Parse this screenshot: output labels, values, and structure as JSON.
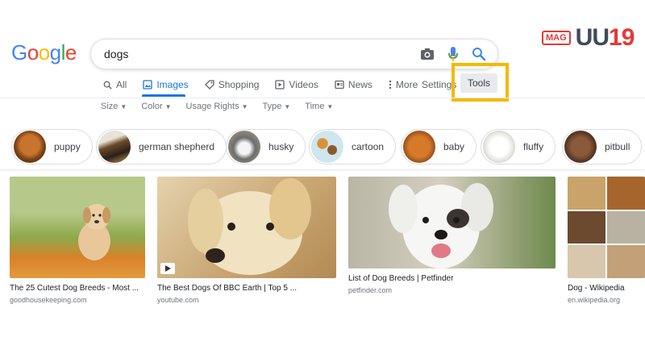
{
  "logo": {
    "text": "Google"
  },
  "search": {
    "query": "dogs"
  },
  "brand": {
    "mag": "MAG",
    "num_a": "UU",
    "num_b": "19"
  },
  "tabs": [
    {
      "label": "All"
    },
    {
      "label": "Images"
    },
    {
      "label": "Shopping"
    },
    {
      "label": "Videos"
    },
    {
      "label": "News"
    },
    {
      "label": "More"
    }
  ],
  "settings": {
    "label": "Settings"
  },
  "tools": {
    "label": "Tools"
  },
  "filters": [
    {
      "label": "Size"
    },
    {
      "label": "Color"
    },
    {
      "label": "Usage Rights"
    },
    {
      "label": "Type"
    },
    {
      "label": "Time"
    }
  ],
  "chips": [
    {
      "label": "puppy"
    },
    {
      "label": "german shepherd"
    },
    {
      "label": "husky"
    },
    {
      "label": "cartoon"
    },
    {
      "label": "baby"
    },
    {
      "label": "fluffy"
    },
    {
      "label": "pitbull"
    }
  ],
  "results": [
    {
      "title": "The 25 Cutest Dog Breeds - Most ...",
      "source": "goodhousekeeping.com"
    },
    {
      "title": "The Best Dogs Of BBC Earth | Top 5 ...",
      "source": "youtube.com"
    },
    {
      "title": "List of Dog Breeds | Petfinder",
      "source": "petfinder.com"
    },
    {
      "title": "Dog - Wikipedia",
      "source": "en.wikipedia.org"
    }
  ],
  "colors": {
    "accent": "#1a73e8",
    "highlight": "#f5b800"
  }
}
